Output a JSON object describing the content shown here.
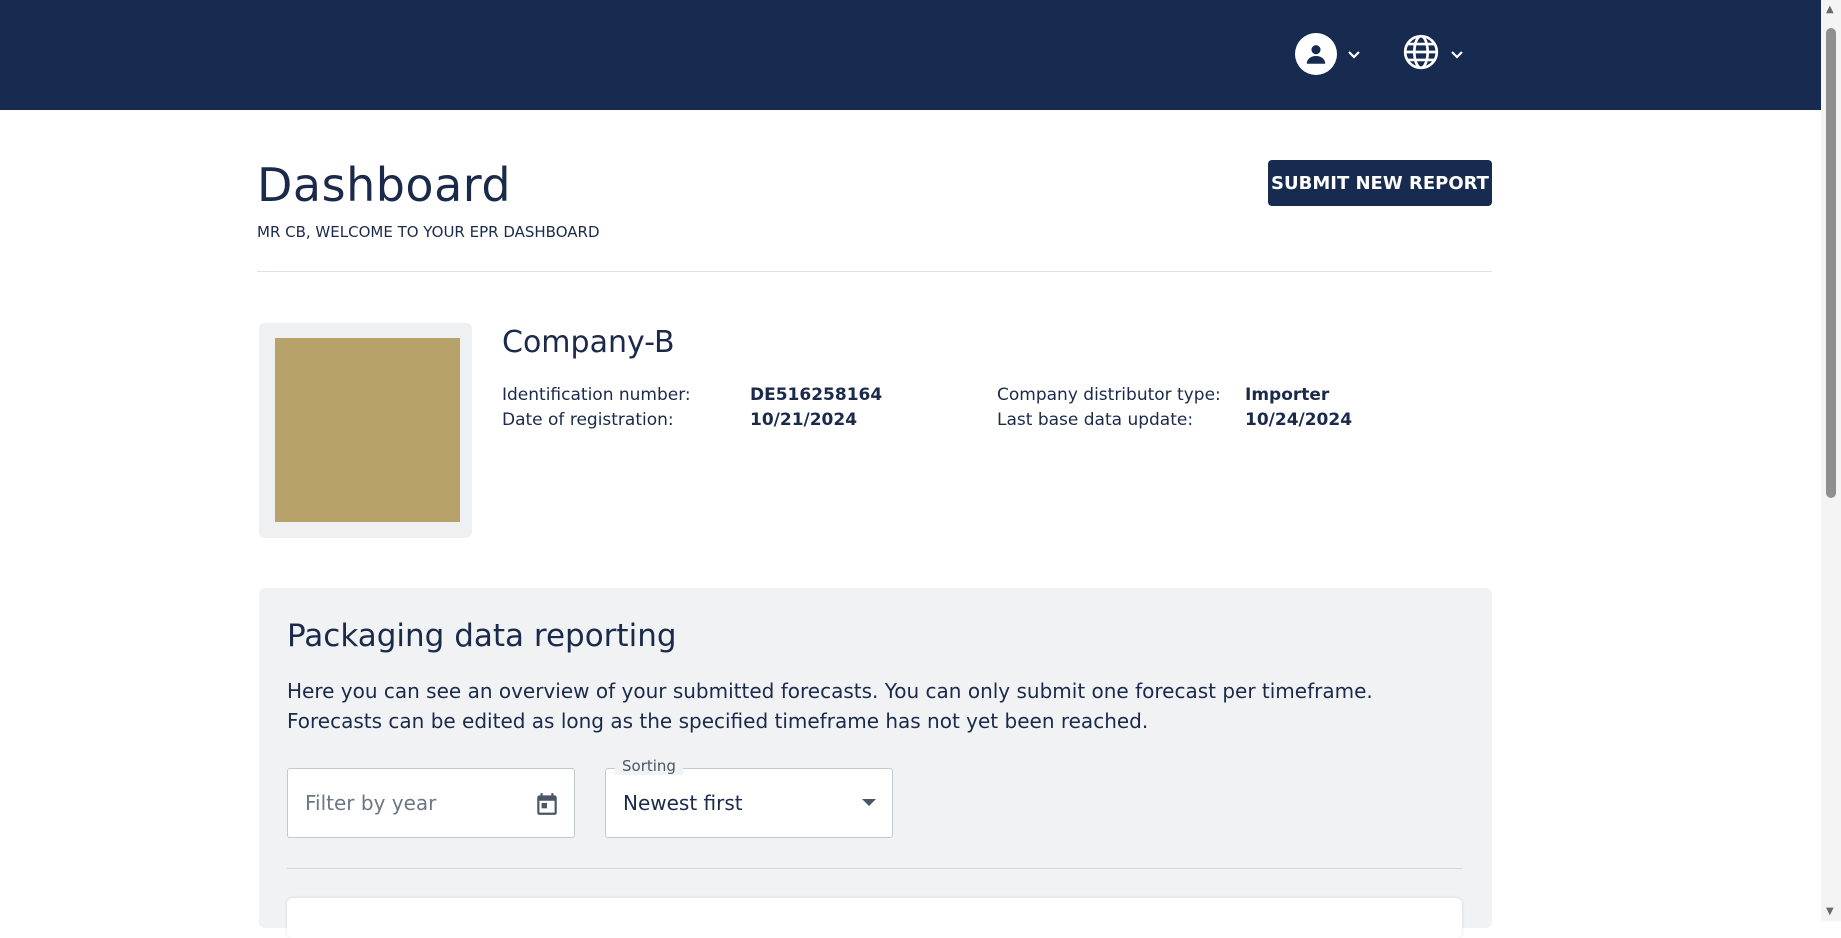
{
  "header": {
    "user_menu_icon": "account-circle-icon",
    "language_menu_icon": "globe-icon",
    "colors": {
      "background": "#172a4f",
      "icon": "#ffffff"
    }
  },
  "page": {
    "title": "Dashboard",
    "welcome": "MR CB, WELCOME TO YOUR EPR DASHBOARD",
    "submit_button": "SUBMIT NEW REPORT"
  },
  "company": {
    "name": "Company-B",
    "logo_color": "#b6a26a",
    "info": [
      {
        "label": "Identification number:",
        "value": "DE516258164"
      },
      {
        "label": "Date of registration:",
        "value": "10/21/2024"
      },
      {
        "label": "Company distributor type:",
        "value": "Importer"
      },
      {
        "label": "Last base data update:",
        "value": "10/24/2024"
      }
    ]
  },
  "reporting": {
    "title": "Packaging data reporting",
    "description": "Here you can see an overview of your submitted forecasts. You can only submit one forecast per timeframe. Forecasts can be edited as long as the specified timeframe has not yet been reached.",
    "filter": {
      "placeholder": "Filter by year",
      "icon": "calendar-icon"
    },
    "sorting": {
      "label": "Sorting",
      "value": "Newest first"
    }
  }
}
